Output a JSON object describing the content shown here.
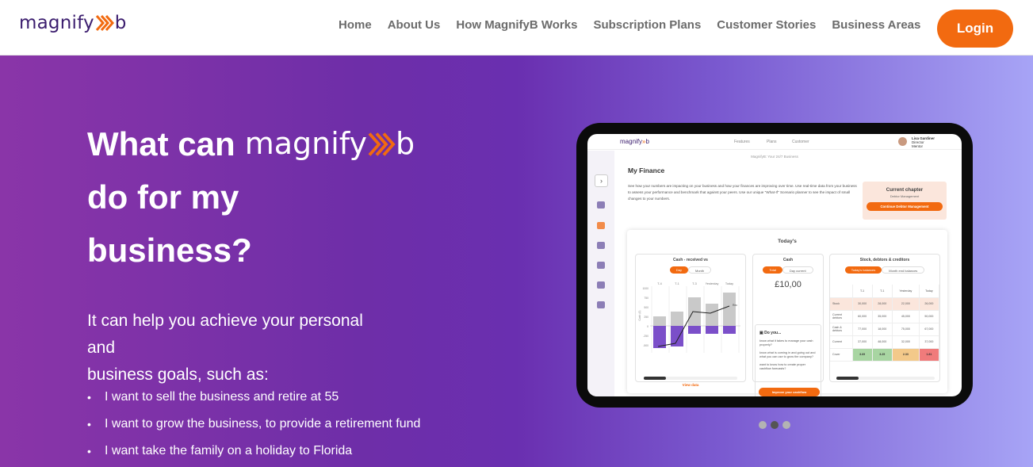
{
  "header": {
    "logo_text_prefix": "magnify",
    "logo_text_suffix": "b",
    "nav": [
      "Home",
      "About Us",
      "How MagnifyB Works",
      "Subscription Plans",
      "Customer Stories",
      "Business Areas"
    ],
    "login_label": "Login"
  },
  "hero": {
    "headline_part1": "What can",
    "headline_logo_prefix": "magnify",
    "headline_logo_suffix": "b",
    "headline_line2": "do for my",
    "headline_line3": "business?",
    "sub_line1": "It can help you achieve your personal",
    "sub_line2": "and",
    "sub_line3": "business goals, such as:",
    "bullets": [
      "I want to sell the business and retire at 55",
      "I want to grow the business, to provide a retirement fund",
      "I want take the family on a holiday to Florida"
    ]
  },
  "tablet": {
    "logo_prefix": "magnify",
    "logo_suffix": "b",
    "nav": [
      "Features",
      "Plans",
      "Customer"
    ],
    "user_name": "Lisa Gardiner",
    "user_role": "Director",
    "user_extra": "Mentor",
    "subtitle": "MagnifyB: Your 24/7 Business",
    "title": "My Finance",
    "paragraph": "See how your numbers are impacting on your business and how your finances are improving over time. Use real-time data from your business to assess your performance and benchmark that against your peers. Use our unique \"What-If\" Scenario planner to see the impact of small changes to your numbers.",
    "chapter_title": "Current chapter",
    "chapter_sub": "Debtor Management",
    "chapter_button": "Continue Debtor Management",
    "today_label": "Today's",
    "cash_chart": {
      "title": "Cash - received vs",
      "pill_on": "Day",
      "pill_off": "Month",
      "col_labels": [
        "T-4",
        "T-1",
        "T-3",
        "Yesterday",
        "Today"
      ],
      "y_labels": [
        "1000",
        "750",
        "500",
        "250",
        "0",
        "-250",
        "-500"
      ],
      "y_axis_label": "Cash (£)",
      "line_end_label": "Rec",
      "view_data": "View data"
    },
    "cash_card": {
      "title": "Cash",
      "pill_on": "Total",
      "pill_off": "Day current",
      "value": "£10,00",
      "did_you_title": "Do you...",
      "did_you_q1": "know what it takes to manage your cash properly?",
      "did_you_q2": "know what is coming in and going out and what you can use to grow the company?",
      "did_you_q3": "want to know how to create proper cashflow forecasts?",
      "did_you_button": "Improve your cashflow"
    },
    "stock_card": {
      "title": "Stock, debtors & creditors",
      "pill_on": "Today's balances",
      "pill_off": "Month end balances",
      "headers": [
        "",
        "T-1",
        "T-1",
        "Yesterday",
        "Today"
      ],
      "rows": [
        {
          "label": "Stock",
          "values": [
            "30,000",
            "28,000",
            "22,000",
            "26,000"
          ]
        },
        {
          "label": "Current debtors",
          "values": [
            "60,000",
            "35,000",
            "45,000",
            "50,000"
          ]
        },
        {
          "label": "Cash & debtors",
          "values": [
            "77,000",
            "18,000",
            "75,000",
            "67,000"
          ]
        },
        {
          "label": "Current",
          "values": [
            "37,000",
            "48,000",
            "32,000",
            "37,000"
          ]
        },
        {
          "label": "Cover",
          "values": [
            "3.69",
            "3.25",
            "2.33",
            "1.81"
          ]
        }
      ],
      "cover_colors": [
        "#a8d5a2",
        "#a8d5a2",
        "#f3c98a",
        "#f07b7b"
      ]
    },
    "carousel_active": 1
  }
}
